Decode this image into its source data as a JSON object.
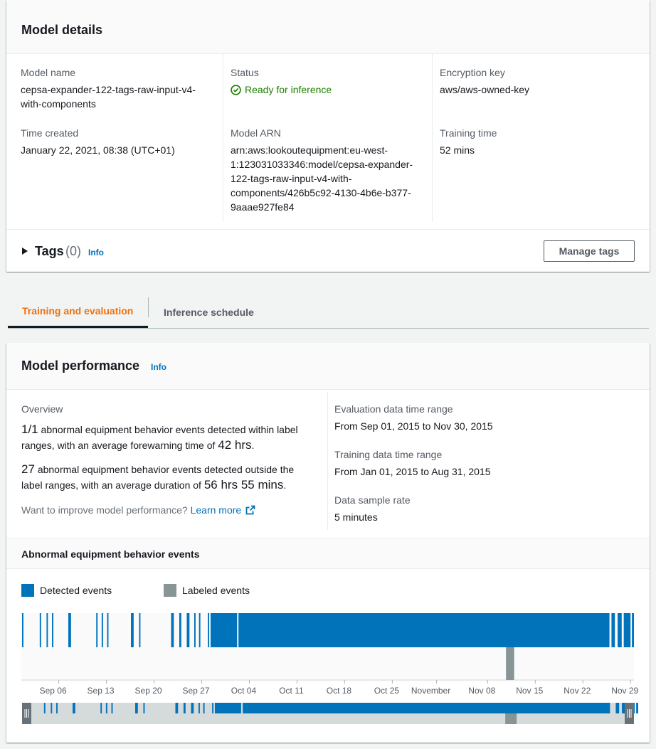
{
  "details": {
    "title": "Model details",
    "model_name_label": "Model name",
    "model_name": "cepsa-expander-122-tags-raw-input-v4-with-components",
    "status_label": "Status",
    "status": "Ready for inference",
    "encryption_label": "Encryption key",
    "encryption": "aws/aws-owned-key",
    "time_created_label": "Time created",
    "time_created": "January 22, 2021, 08:38 (UTC+01)",
    "arn_label": "Model ARN",
    "arn_lines": [
      "arn:aws:lookoutequipment:eu-west-",
      "1:123031033346:model/cepsa-expander-",
      "122-tags-raw-input-v4-with-",
      "components/426b5c92-4130-4b6e-b377-",
      "9aaae927fe84"
    ],
    "training_time_label": "Training time",
    "training_time": "52 mins",
    "model_name_lines": [
      "cepsa-expander-122-tags-raw-input-v4-",
      "with-components"
    ]
  },
  "tags": {
    "title": "Tags",
    "count": "(0)",
    "info": "Info",
    "manage_button": "Manage tags"
  },
  "tabs": [
    {
      "label": "Training and evaluation",
      "active": true
    },
    {
      "label": "Inference schedule",
      "active": false
    }
  ],
  "performance": {
    "title": "Model performance",
    "info": "Info",
    "overview_label": "Overview",
    "ov1_big": "1/1",
    "ov1_text_a": "abnormal equipment behavior events detected within label",
    "ov1_text_b": "ranges, with an average forewarning time of",
    "ov1_big2": "42 hrs",
    "ov2_big": "27",
    "ov2_text_a": "abnormal equipment behavior events detected outside the",
    "ov2_text_b": "label ranges, with an average duration of",
    "ov2_big2": "56 hrs 55 mins",
    "improve_text": "Want to improve model performance?",
    "learn_more": "Learn more",
    "eval_label": "Evaluation data time range",
    "eval_value": "From Sep 01, 2015 to Nov 30, 2015",
    "train_label": "Training data time range",
    "train_value": "From Jan 01, 2015 to Aug 31, 2015",
    "sample_label": "Data sample rate",
    "sample_value": "5 minutes",
    "events_title": "Abnormal equipment behavior events"
  },
  "legend": [
    {
      "label": "Detected events",
      "color": "#0073bb"
    },
    {
      "label": "Labeled events",
      "color": "#879596"
    }
  ],
  "chart_data": {
    "type": "timeline",
    "x_ticks": [
      "Sep 06",
      "Sep 13",
      "Sep 20",
      "Sep 27",
      "Oct 04",
      "Oct 11",
      "Oct 18",
      "Oct 25",
      "November",
      "Nov 08",
      "Nov 15",
      "Nov 22",
      "Nov 29"
    ],
    "x_range": [
      "2015-09-01",
      "2015-11-30"
    ],
    "series": [
      {
        "name": "Detected events",
        "color": "#0073bb",
        "events_day_of_period": [
          [
            0.1,
            0.3
          ],
          [
            2.7,
            2.9
          ],
          [
            3.7,
            3.9
          ],
          [
            4.5,
            4.7
          ],
          [
            6.9,
            7.3
          ],
          [
            11.0,
            11.2
          ],
          [
            11.8,
            12.0
          ],
          [
            12.6,
            12.8
          ],
          [
            16.1,
            16.5
          ],
          [
            17.3,
            17.5
          ],
          [
            22.0,
            22.4
          ],
          [
            23.2,
            23.5
          ],
          [
            24.3,
            24.7
          ],
          [
            25.4,
            25.6
          ],
          [
            26.1,
            26.3
          ],
          [
            27.4,
            27.6
          ],
          [
            27.8,
            31.7
          ],
          [
            31.9,
            86.4
          ],
          [
            86.7,
            87.2
          ],
          [
            87.6,
            88.2
          ],
          [
            88.5,
            89.5
          ],
          [
            89.7,
            90.0
          ]
        ]
      },
      {
        "name": "Labeled events",
        "color": "#879596",
        "events_day_of_period": [
          [
            71.2,
            72.4
          ]
        ]
      }
    ]
  }
}
